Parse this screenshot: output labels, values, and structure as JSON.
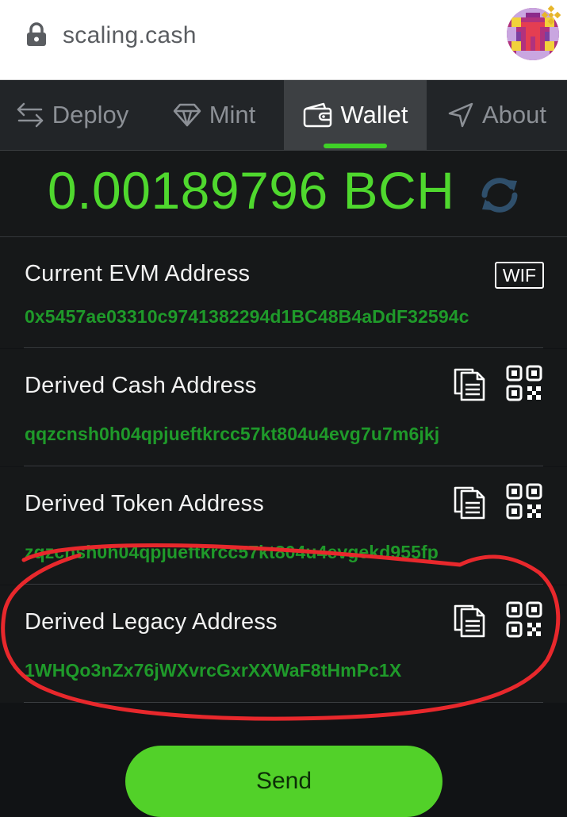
{
  "browser": {
    "url": "scaling.cash"
  },
  "tabs": [
    {
      "label": "Deploy"
    },
    {
      "label": "Mint"
    },
    {
      "label": "Wallet"
    },
    {
      "label": "About"
    }
  ],
  "active_tab": "Wallet",
  "balance": {
    "text": "0.00189796 BCH"
  },
  "evm": {
    "label": "Current EVM Address",
    "address": "0x5457ae03310c9741382294d1BC48B4aDdF32594c",
    "wif_label": "WIF"
  },
  "cash": {
    "label": "Derived Cash Address",
    "address": "qqzcnsh0h04qpjueftkrcc57kt804u4evg7u7m6jkj"
  },
  "token": {
    "label": "Derived Token Address",
    "address": "zqzcnsh0h04qpjueftkrcc57kt804u4evgekd955fp"
  },
  "legacy": {
    "label": "Derived Legacy Address",
    "address": "1WHQo3nZx76jWXvrcGxrXXWaF8tHmPc1X"
  },
  "send": {
    "label": "Send"
  },
  "colors": {
    "accent": "#4fd82e",
    "address": "#1f9a2a",
    "background": "#161819",
    "annotation": "#e8282c"
  }
}
